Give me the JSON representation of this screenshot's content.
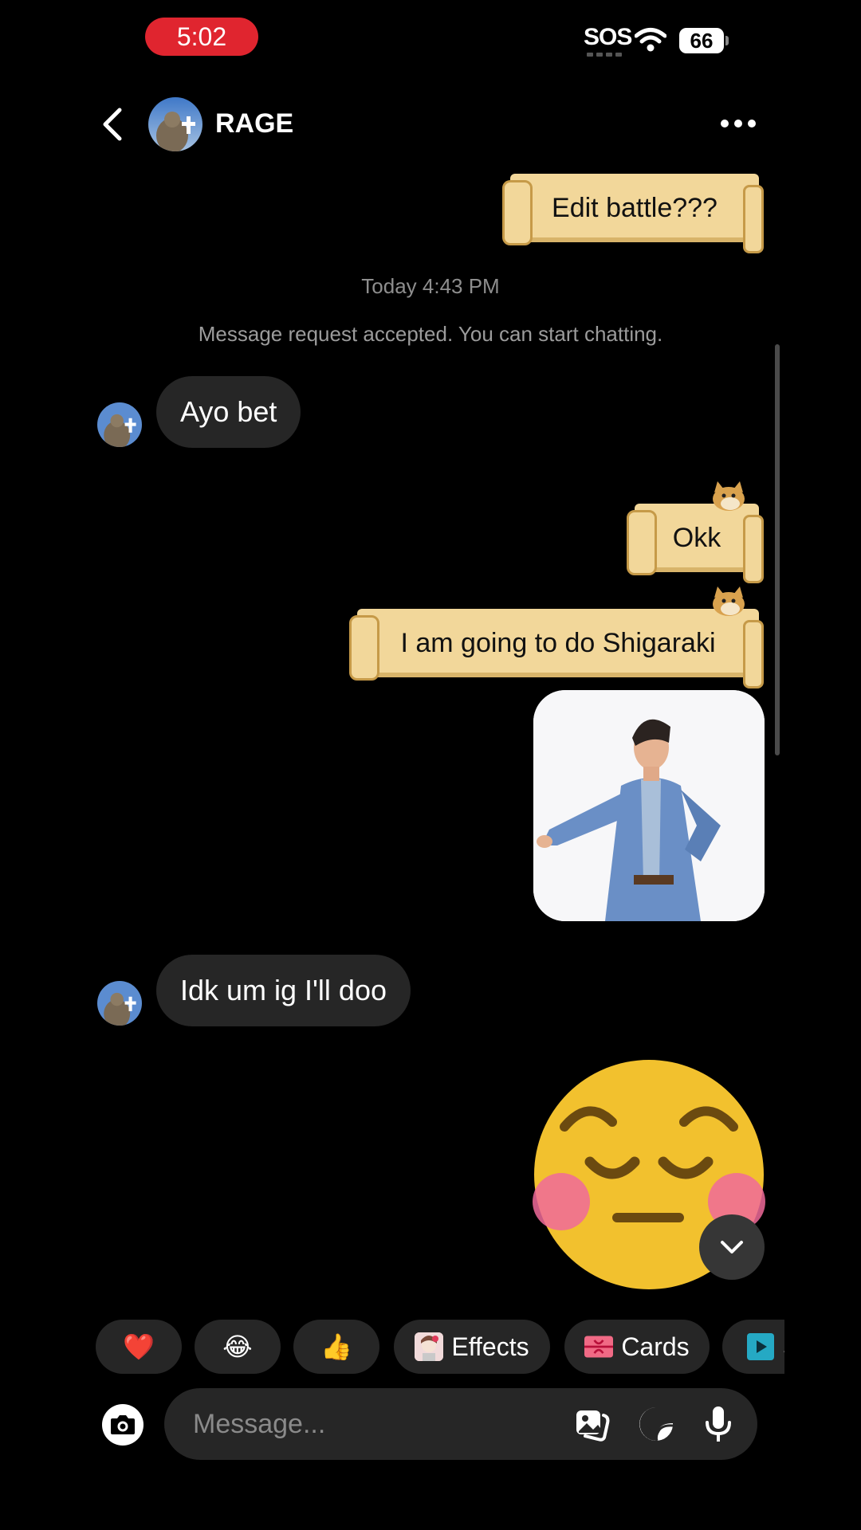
{
  "status_bar": {
    "time": "5:02",
    "sos": "SOS",
    "battery": "66"
  },
  "header": {
    "name": "RAGE"
  },
  "messages": {
    "out_edit": "Edit battle???",
    "timestamp": "Today 4:43 PM",
    "system": "Message request accepted. You can start chatting.",
    "in_1": "Ayo bet",
    "out_okk": "Okk",
    "out_shigaraki": "I am going to do Shigaraki",
    "in_2": "Idk um ig I'll doo"
  },
  "quick_actions": {
    "heart": "❤️",
    "laugh": "😂",
    "thumbs": "👍",
    "effects": "Effects",
    "cards": "Cards",
    "partial": "S"
  },
  "composer": {
    "placeholder": "Message..."
  },
  "colors": {
    "bubble_in": "#262626",
    "banner": "#f2d79a",
    "time_pill": "#e0252f"
  },
  "icons": [
    "chevron-left-icon",
    "more-icon",
    "camera-icon",
    "gallery-icon",
    "sticker-icon",
    "microphone-icon",
    "chevron-down-icon",
    "wifi-icon"
  ]
}
